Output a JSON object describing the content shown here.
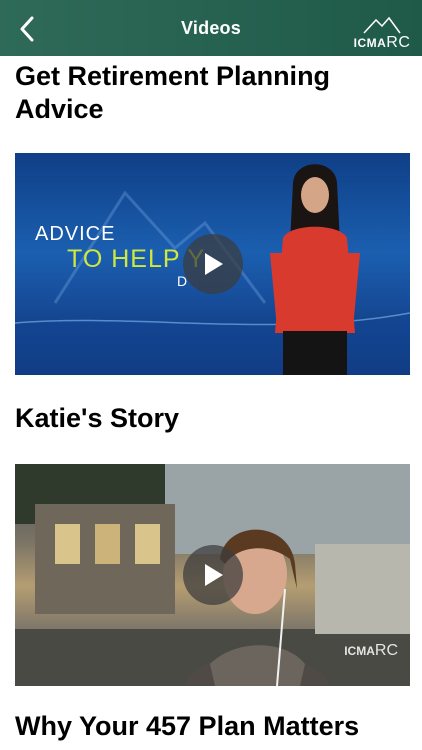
{
  "header": {
    "title": "Videos",
    "logo_text": "ICMA",
    "logo_text_rc": "RC"
  },
  "videos": [
    {
      "title": "Get Retirement Planning Advice",
      "thumb_caption_line1": "ADVICE",
      "thumb_caption_line2": "TO HELP Y",
      "thumb_caption_line3": "D"
    },
    {
      "title": "Katie's Story",
      "watermark_text": "ICMA",
      "watermark_text_rc": "RC"
    },
    {
      "title": "Why Your 457 Plan Matters"
    }
  ],
  "colors": {
    "header_bg": "#2f6a59",
    "accent_text": "#cfe73f"
  }
}
